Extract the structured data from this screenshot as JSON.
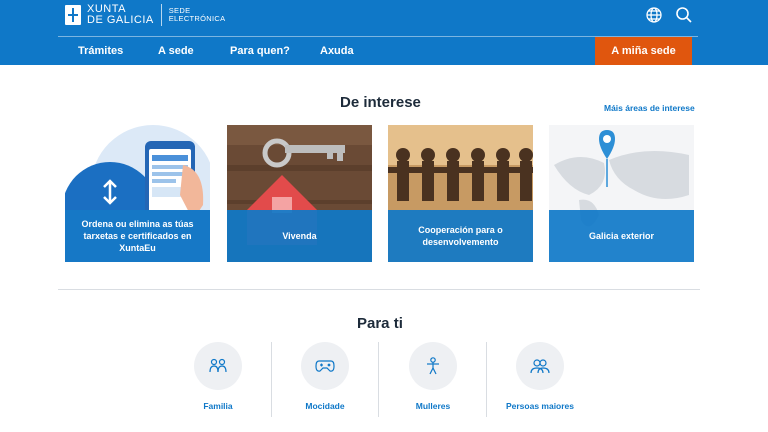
{
  "header": {
    "logo_line1": "XUNTA",
    "logo_line2": "DE GALICIA",
    "logo_sub1": "SEDE",
    "logo_sub2": "ELECTRÓNICA",
    "language_icon": "globe-icon",
    "search_icon": "search-icon"
  },
  "nav": {
    "items": [
      "Trámites",
      "A sede",
      "Para quen?",
      "Axuda"
    ],
    "cta": "A miña sede"
  },
  "interest": {
    "title": "De interese",
    "more_link": "Máis áreas de interese",
    "cards": [
      {
        "label": "Ordena ou elimina as túas tarxetas e certificados en XuntaEu"
      },
      {
        "label": "Vivenda"
      },
      {
        "label": "Cooperación para o desenvolvemento"
      },
      {
        "label": "Galicia exterior"
      }
    ]
  },
  "for_you": {
    "title": "Para ti",
    "items": [
      {
        "label": "Familia",
        "icon": "family-icon"
      },
      {
        "label": "Mocidade",
        "icon": "gamepad-icon"
      },
      {
        "label": "Mulleres",
        "icon": "woman-icon"
      },
      {
        "label": "Persoas maiores",
        "icon": "elderly-icon"
      }
    ]
  },
  "colors": {
    "brand": "#0f78c8",
    "cta": "#e0560e"
  }
}
